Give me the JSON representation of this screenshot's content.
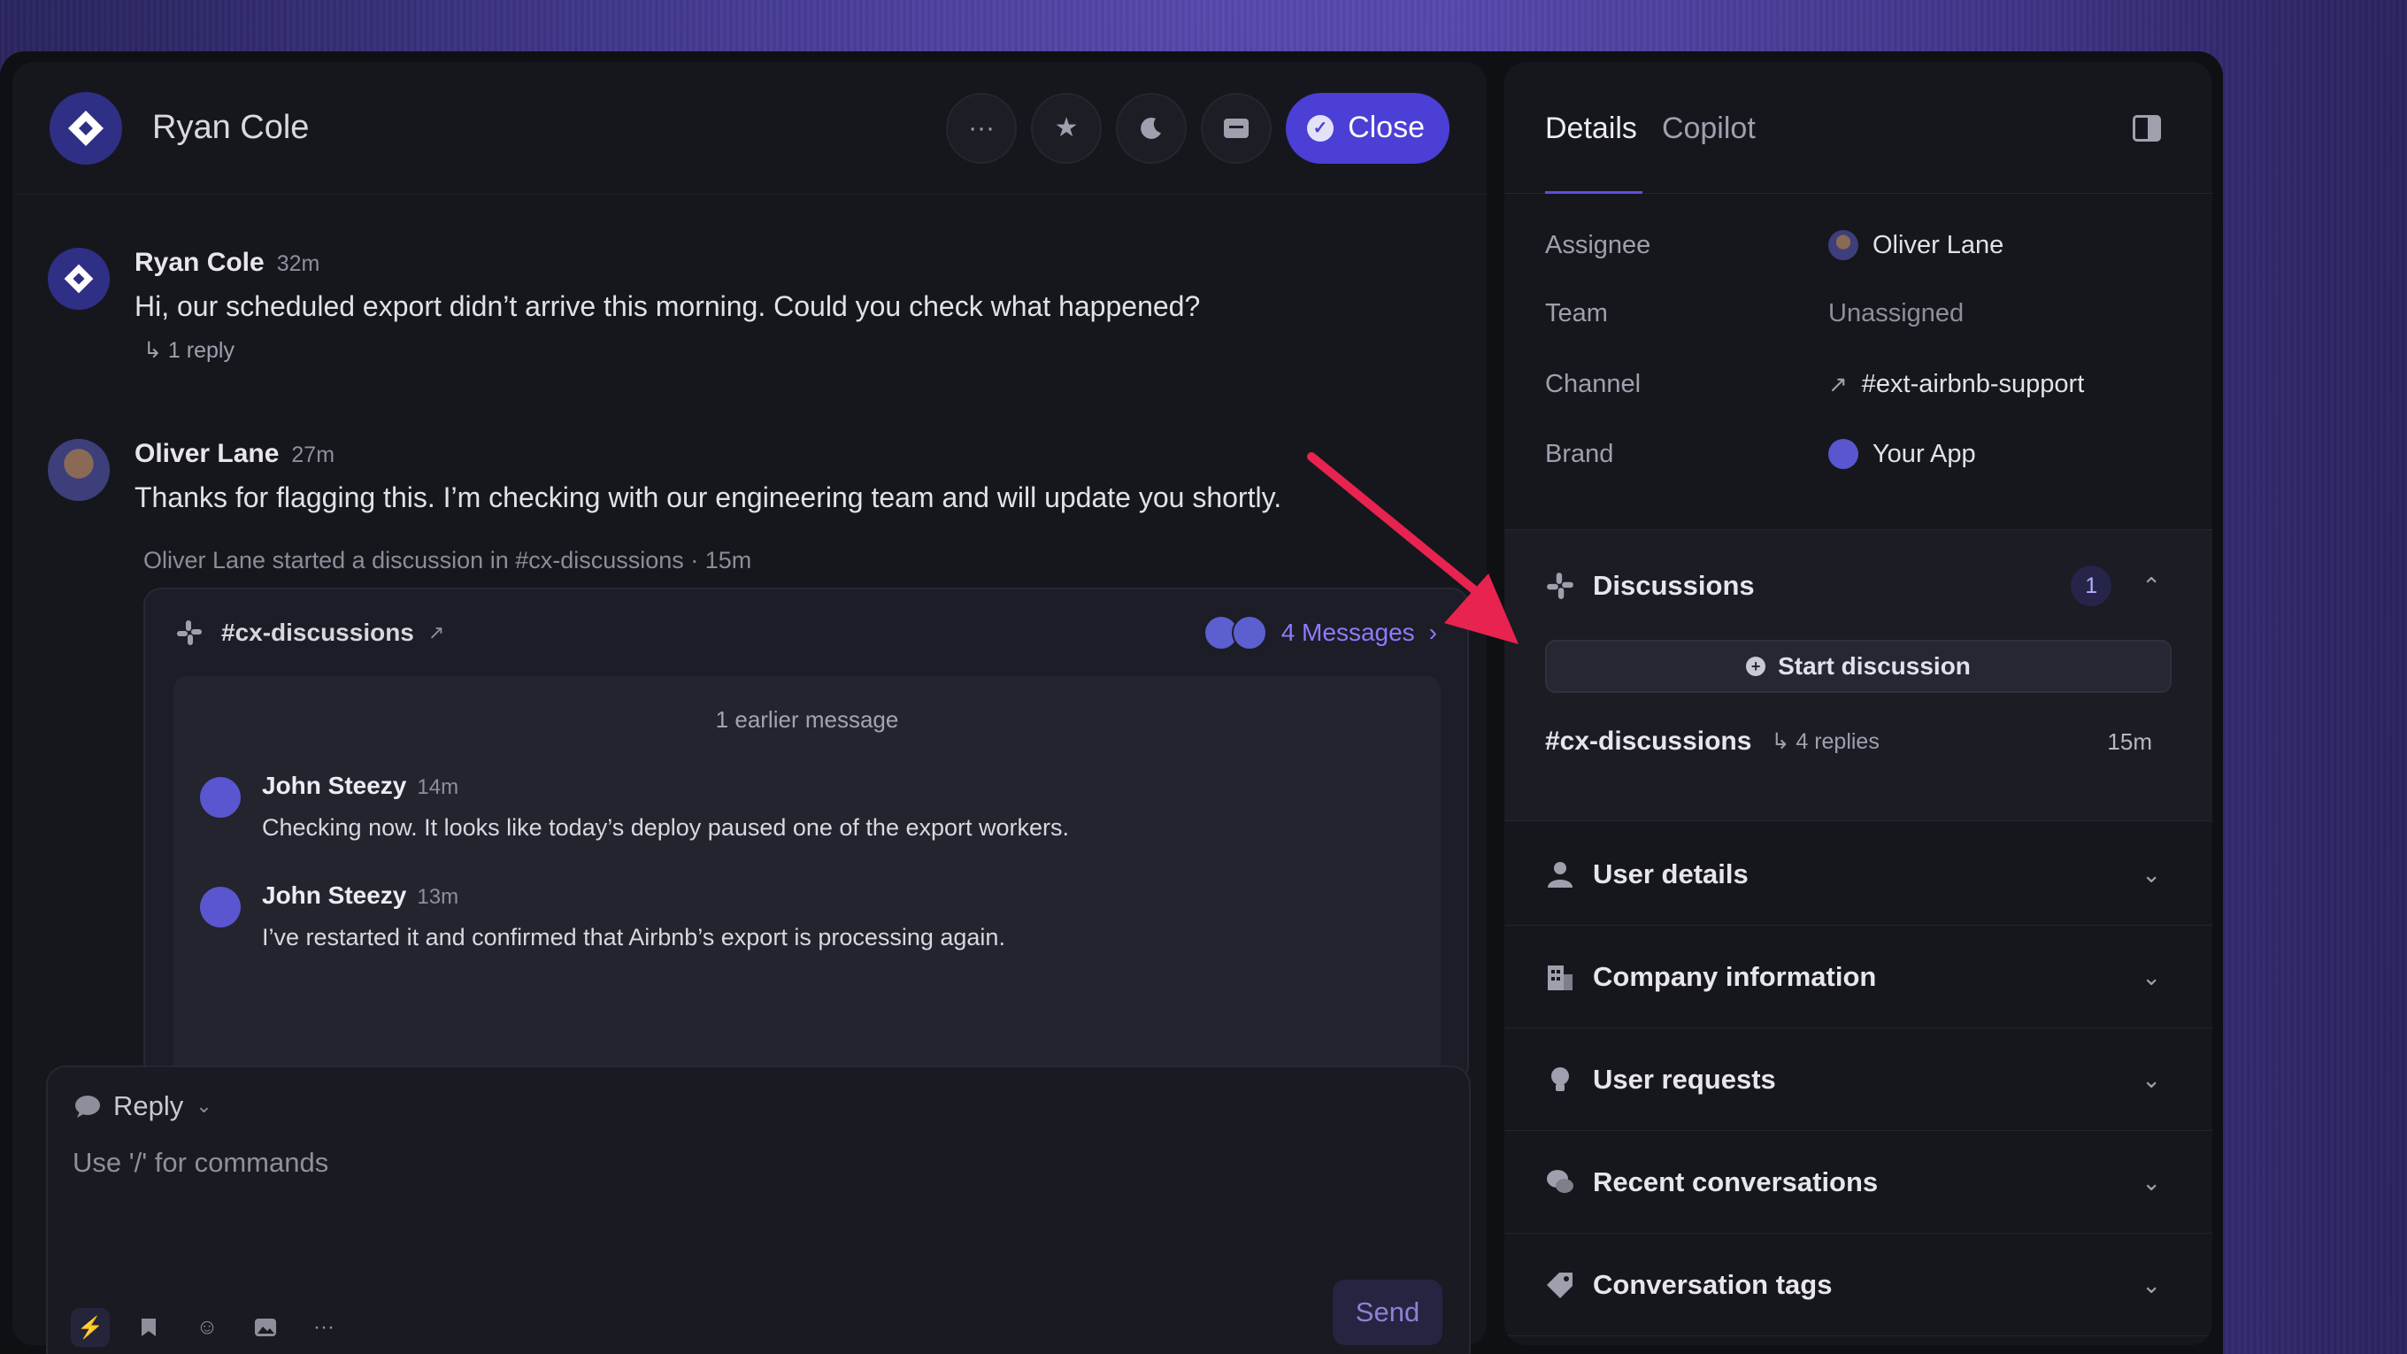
{
  "header": {
    "name": "Ryan Cole",
    "close_label": "Close"
  },
  "messages": [
    {
      "name": "Ryan Cole",
      "time": "32m",
      "text": "Hi, our scheduled export didn’t arrive this morning. Could you check what happened?",
      "reply": "1 reply"
    },
    {
      "name": "Oliver Lane",
      "time": "27m",
      "text": "Thanks for flagging this. I’m checking with our engineering team and will update you shortly."
    }
  ],
  "system_note": "Oliver Lane started a discussion in #cx-discussions · 15m",
  "discussion_card": {
    "channel": "#cx-discussions",
    "messages_label": "4 Messages",
    "earlier": "1 earlier message",
    "items": [
      {
        "name": "John Steezy",
        "time": "14m",
        "text": "Checking now. It looks like today’s deploy paused one of the export workers."
      },
      {
        "name": "John Steezy",
        "time": "13m",
        "text": "I’ve restarted it and confirmed that Airbnb’s export is processing again."
      }
    ]
  },
  "composer": {
    "mode": "Reply",
    "placeholder": "Use '/' for commands",
    "send": "Send"
  },
  "sidebar": {
    "tabs": [
      "Details",
      "Copilot"
    ],
    "details": [
      {
        "key": "Assignee",
        "value": "Oliver Lane"
      },
      {
        "key": "Team",
        "value": "Unassigned"
      },
      {
        "key": "Channel",
        "value": "#ext-airbnb-support"
      },
      {
        "key": "Brand",
        "value": "Your App"
      }
    ],
    "discussions": {
      "title": "Discussions",
      "count": "1",
      "start_label": "Start discussion",
      "item": {
        "name": "#cx-discussions",
        "replies": "4 replies",
        "time": "15m"
      }
    },
    "sections": [
      "User details",
      "Company information",
      "User requests",
      "Recent conversations",
      "Conversation tags"
    ]
  },
  "colors": {
    "accent": "#4b3fd6",
    "arrow": "#e8234f"
  }
}
